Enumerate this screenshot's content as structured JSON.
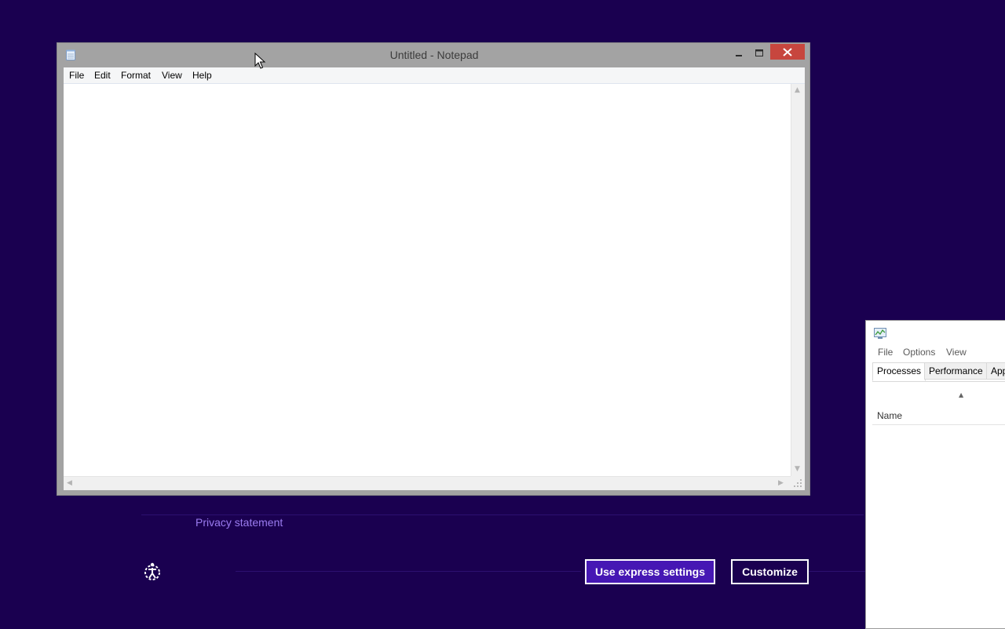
{
  "oobe": {
    "privacy_link": "Privacy statement",
    "express_button": "Use express settings",
    "customize_button": "Customize",
    "ease_of_access_icon": "ease-of-access-icon"
  },
  "notepad": {
    "title": "Untitled - Notepad",
    "menu": [
      "File",
      "Edit",
      "Format",
      "View",
      "Help"
    ],
    "content": ""
  },
  "taskmgr": {
    "menu": [
      "File",
      "Options",
      "View"
    ],
    "tabs": [
      "Processes",
      "Performance",
      "App"
    ],
    "active_tab": "Processes",
    "column_name": "Name"
  },
  "colors": {
    "background": "#1a0050",
    "express_button": "#4617b4",
    "close_button": "#c7463e",
    "link": "#9b7cf0"
  }
}
